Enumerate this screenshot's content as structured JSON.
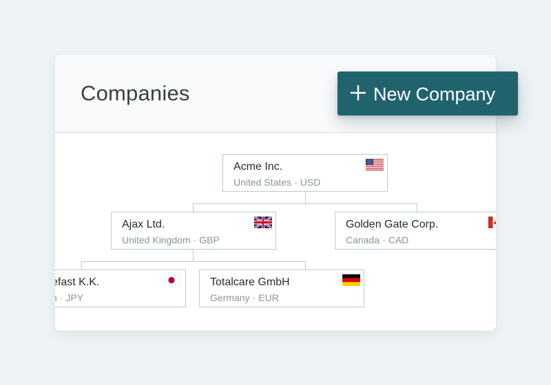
{
  "header": {
    "title": "Companies"
  },
  "actions": {
    "new_company_label": "New Company",
    "new_company_icon": "plus-icon",
    "button_color": "#21636d"
  },
  "companies": [
    {
      "name": "Acme Inc.",
      "country": "United States",
      "currency": "USD",
      "flag": "us-flag-icon"
    },
    {
      "name": "Ajax Ltd.",
      "country": "United Kingdom",
      "currency": "GBP",
      "flag": "uk-flag-icon",
      "parent": "Acme Inc."
    },
    {
      "name": "Golden Gate Corp.",
      "country": "Canada",
      "currency": "CAD",
      "flag": "canada-flag-icon",
      "parent": "Acme Inc."
    },
    {
      "name": "efast K.K.",
      "country": "n",
      "currency": "JPY",
      "flag": "japan-flag-icon",
      "parent": "Ajax Ltd."
    },
    {
      "name": "Totalcare GmbH",
      "country": "Germany",
      "currency": "EUR",
      "flag": "germany-flag-icon",
      "parent": "Ajax Ltd."
    }
  ]
}
